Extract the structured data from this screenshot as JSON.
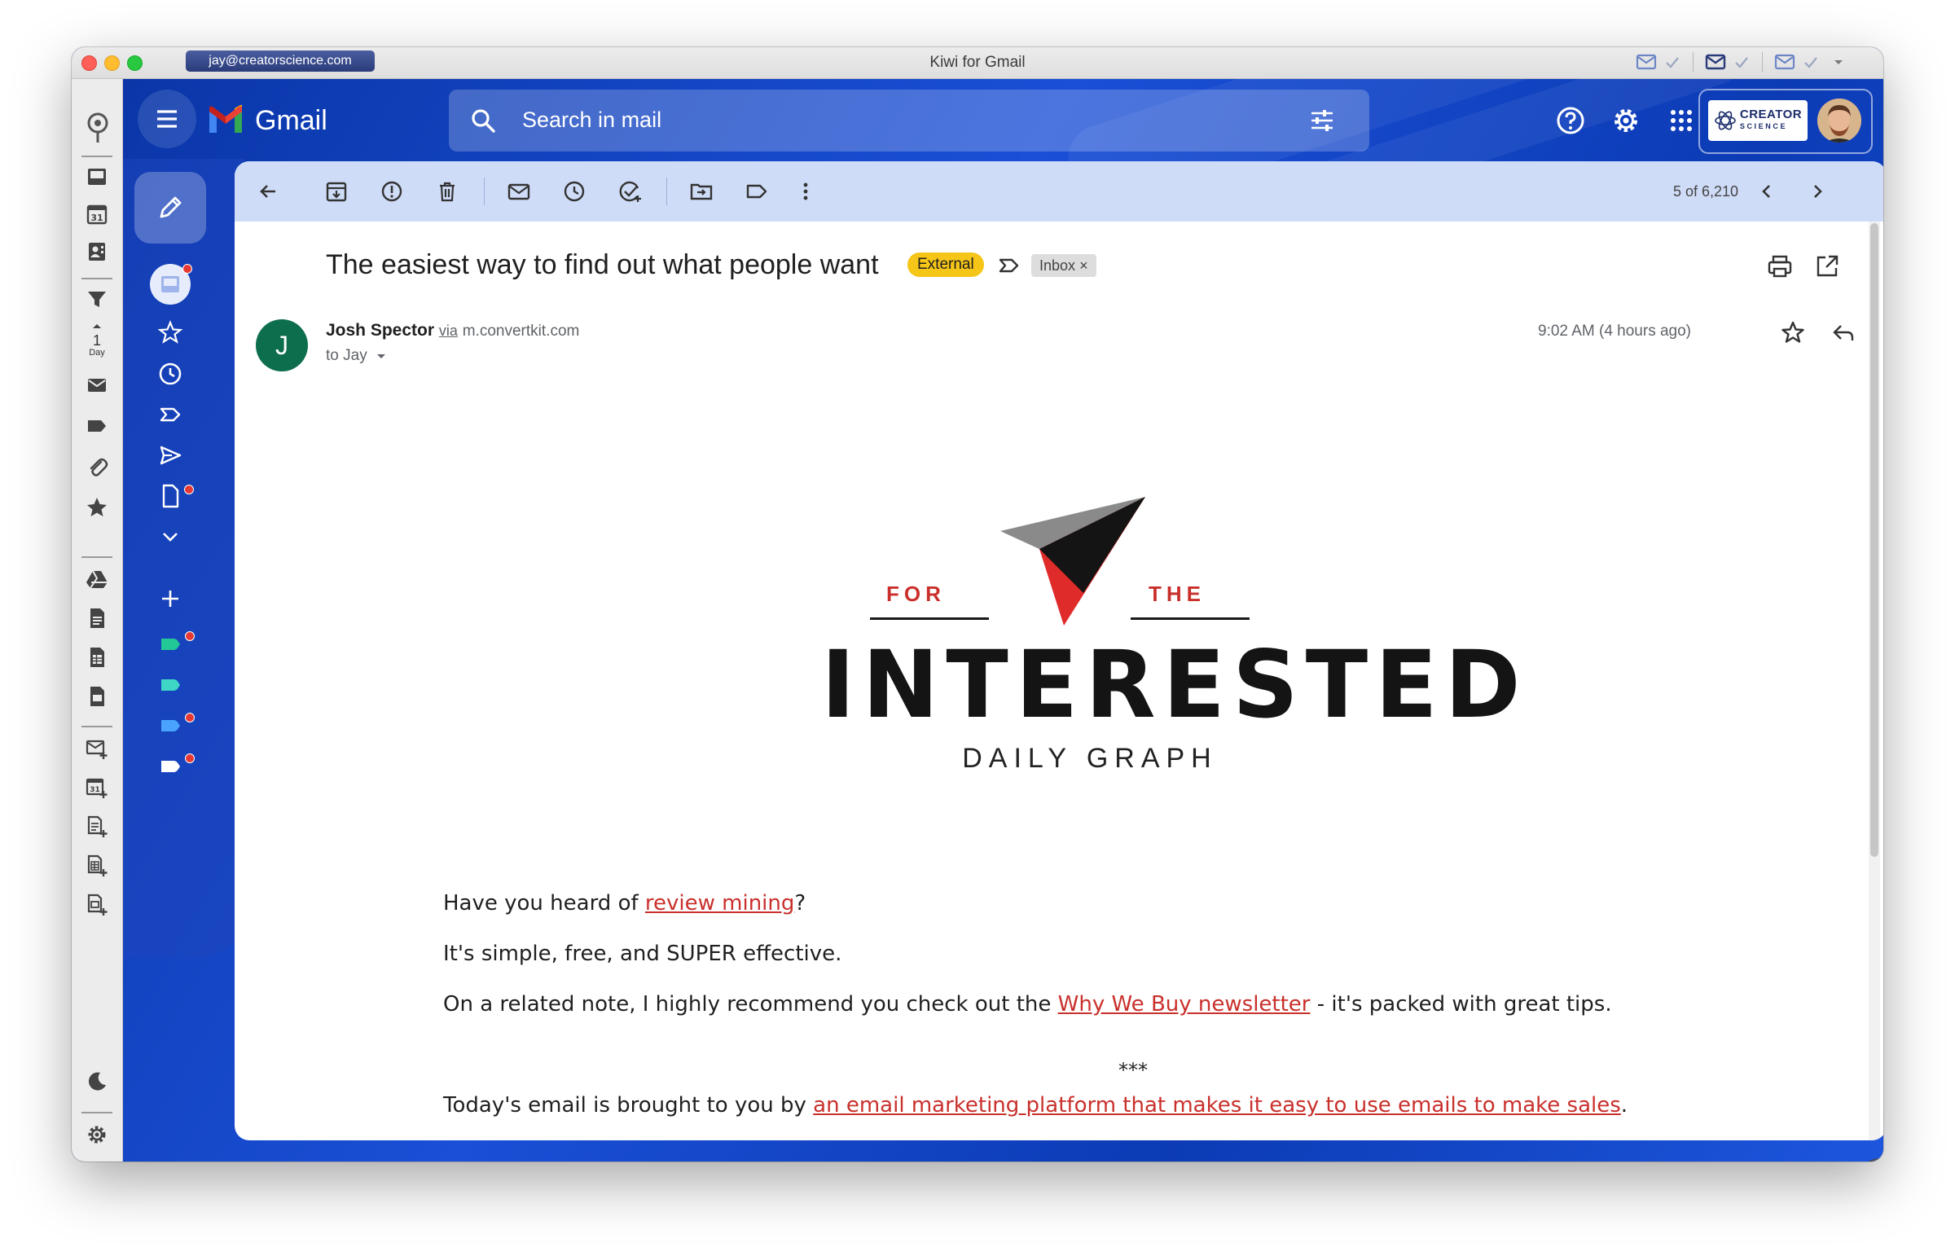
{
  "window": {
    "title": "Kiwi for Gmail",
    "account_email": "jay@creatorscience.com"
  },
  "colors": {
    "gmail_blue": "#1349c9",
    "toolbar_bg": "#cfdcf7",
    "external_badge": "#f5c518",
    "link_red": "#c9302c",
    "sender_avatar": "#0d6e4d"
  },
  "kiwi_sidebar": {
    "day_filter": {
      "number": "1",
      "unit": "Day"
    }
  },
  "gmail_header": {
    "brand": "Gmail",
    "search_placeholder": "Search in mail",
    "account_logo": {
      "line1": "CREATOR",
      "line2": "SCIENCE"
    }
  },
  "toolbar": {
    "count": "5 of 6,210"
  },
  "email": {
    "subject": "The easiest way to find out what people want",
    "external_label": "External",
    "inbox_label": "Inbox",
    "inbox_remove": "×",
    "sender_initial": "J",
    "sender_name": "Josh Spector",
    "via": "via",
    "sender_domain": "m.convertkit.com",
    "to": "to Jay",
    "time": "9:02 AM (4 hours ago)"
  },
  "newsletter_logo": {
    "for": "FOR",
    "the": "THE",
    "main": "INTERESTED",
    "sub": "DAILY GRAPH"
  },
  "body": {
    "p1_before": "Have you heard of ",
    "p1_link": "review mining",
    "p1_after": "?",
    "p2": "It's simple, free, and SUPER effective.",
    "p3_before": "On a related note, I highly recommend you check out the ",
    "p3_link": "Why We Buy newsletter",
    "p3_after": " - it's packed with great tips.",
    "separator": "***",
    "p4_before": "Today's email is brought to you by ",
    "p4_link": "an email marketing platform that makes it easy to use emails to make sales",
    "p4_after": "."
  }
}
